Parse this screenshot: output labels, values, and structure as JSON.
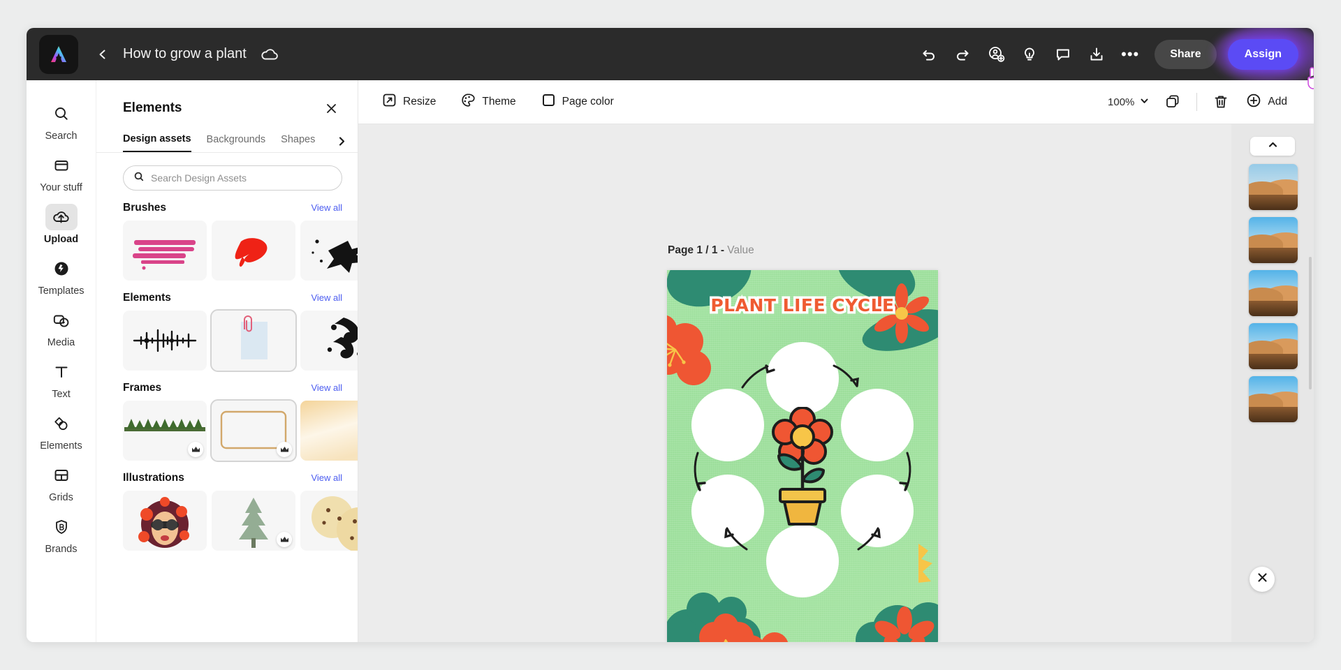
{
  "topbar": {
    "logo_icon": "adobe-express-logo",
    "back_icon": "chevron-left-icon",
    "doc_title": "How to grow a plant",
    "cloud_icon": "cloud-saved-icon",
    "undo_icon": "undo-icon",
    "redo_icon": "redo-icon",
    "invite_icon": "add-collaborator-icon",
    "ideas_icon": "lightbulb-icon",
    "comment_icon": "comment-icon",
    "download_icon": "download-icon",
    "more_icon": "more-options-icon",
    "more_label": "•••",
    "share_label": "Share",
    "assign_label": "Assign",
    "cursor_icon": "hand-pointer-cursor"
  },
  "rail": {
    "items": [
      {
        "label": "Search",
        "icon": "search-icon",
        "active": false
      },
      {
        "label": "Your stuff",
        "icon": "folder-icon",
        "active": false
      },
      {
        "label": "Upload",
        "icon": "upload-cloud-icon",
        "active": true
      },
      {
        "label": "Templates",
        "icon": "templates-icon",
        "active": false
      },
      {
        "label": "Media",
        "icon": "media-icon",
        "active": false
      },
      {
        "label": "Text",
        "icon": "text-icon",
        "active": false
      },
      {
        "label": "Elements",
        "icon": "elements-icon",
        "active": false
      },
      {
        "label": "Grids",
        "icon": "grids-icon",
        "active": false
      },
      {
        "label": "Brands",
        "icon": "brands-icon",
        "active": false
      }
    ]
  },
  "panel": {
    "title": "Elements",
    "close_icon": "close-icon",
    "next_tab_icon": "chevron-right-icon",
    "tabs": [
      {
        "label": "Design assets",
        "active": true
      },
      {
        "label": "Backgrounds",
        "active": false
      },
      {
        "label": "Shapes",
        "active": false
      }
    ],
    "search": {
      "icon": "search-icon",
      "value": "",
      "placeholder": "Search Design Assets"
    },
    "view_all_label": "View all",
    "sections": [
      {
        "title": "Brushes",
        "items": [
          "pink-brush-stroke",
          "red-paint-stroke",
          "black-splatter"
        ]
      },
      {
        "title": "Elements",
        "items": [
          "audio-waveform",
          "paper-with-paperclip",
          "black-floral-flourish"
        ]
      },
      {
        "title": "Frames",
        "items": [
          "pine-branch-frame",
          "tan-rounded-frame",
          "cream-gradient-frame"
        ]
      },
      {
        "title": "Illustrations",
        "items": [
          "woman-with-flowers",
          "pine-tree-watercolor",
          "cookies-illustration"
        ]
      }
    ]
  },
  "canvas_toolbar": {
    "resize_label": "Resize",
    "resize_icon": "resize-icon",
    "theme_label": "Theme",
    "theme_icon": "palette-icon",
    "page_color_label": "Page color",
    "page_color_icon": "square-swatch-icon",
    "zoom_value": "100%",
    "zoom_chevron_icon": "chevron-down-icon",
    "duplicate_icon": "duplicate-page-icon",
    "delete_icon": "trash-icon",
    "add_label": "Add",
    "add_icon": "plus-circle-icon"
  },
  "canvas": {
    "page_label_bold": "Page 1 / 1 -",
    "page_label_value": "Value",
    "artwork": {
      "title": "Plant Life Cycle",
      "title_color": "#ef5b32",
      "background_color": "#9fe09e",
      "accent_orange": "#ef5633",
      "accent_teal": "#2e8b72",
      "accent_yellow": "#f7c548",
      "flower_center_color": "#f7c548",
      "pot_color": "#f3c44a",
      "circle_count": 7,
      "arrow_count": 6
    }
  },
  "thumb_panel": {
    "collapse_icon": "chevron-up-icon",
    "close_icon": "close-icon",
    "thumbnails": [
      "desert-dunes-1",
      "desert-dunes-2",
      "desert-dunes-3",
      "desert-dunes-4",
      "desert-dunes-5"
    ]
  }
}
